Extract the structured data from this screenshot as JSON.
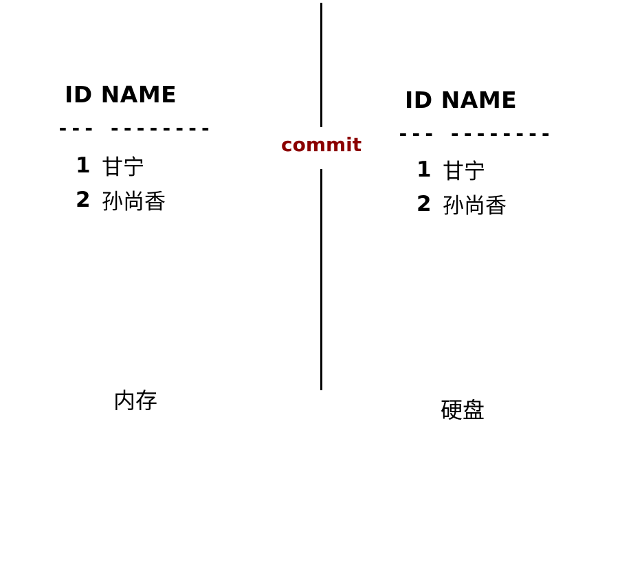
{
  "left_table": {
    "header": "ID NAME",
    "separator": "--- --------",
    "rows": [
      {
        "id": "1",
        "name": "甘宁"
      },
      {
        "id": "2",
        "name": "孙尚香"
      }
    ],
    "caption": "内存"
  },
  "right_table": {
    "header": "ID NAME",
    "separator": "--- --------",
    "rows": [
      {
        "id": "1",
        "name": "甘宁"
      },
      {
        "id": "2",
        "name": "孙尚香"
      }
    ],
    "caption": "硬盘"
  },
  "divider": {
    "label": "commit",
    "label_color": "#8b0000"
  }
}
